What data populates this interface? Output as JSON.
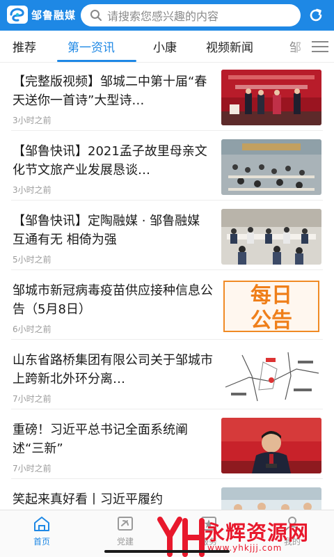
{
  "header": {
    "app_name": "邹鲁融媒",
    "search_placeholder": "请搜索您感兴趣的内容",
    "logo_icon": "app-logo-icon",
    "search_icon": "search-icon",
    "refresh_icon": "refresh-icon"
  },
  "tabs": [
    {
      "label": "推荐",
      "active": false
    },
    {
      "label": "第一资讯",
      "active": true
    },
    {
      "label": "小康",
      "active": false
    },
    {
      "label": "视频新闻",
      "active": false
    },
    {
      "label": "邹",
      "active": false
    }
  ],
  "feed": [
    {
      "title": "【完整版视频】邹城二中第十届“春天送你一首诗”大型诗…",
      "time": "3小时之前"
    },
    {
      "title": "【邹鲁快讯】2021孟子故里母亲文化节文旅产业发展恳谈…",
      "time": "3小时之前"
    },
    {
      "title": "【邹鲁快讯】定陶融媒 · 邹鲁融媒 互通有无 相倚为强",
      "time": "5小时之前"
    },
    {
      "title": "邹城市新冠病毒疫苗供应接种信息公告（5月8日）",
      "time": "6小时之前",
      "thumb_text": [
        "每日",
        "公告"
      ]
    },
    {
      "title": "山东省路桥集团有限公司关于邹城市上跨新北外环分离…",
      "time": "7小时之前"
    },
    {
      "title": "重磅！习近平总书记全面系统阐述“三新”",
      "time": "7小时之前"
    },
    {
      "title": "笑起来真好看丨习近平履约",
      "time": ""
    }
  ],
  "bottom_nav": [
    {
      "label": "首页",
      "icon": "home-icon",
      "active": true
    },
    {
      "label": "党建",
      "icon": "party-flag-icon",
      "active": false
    },
    {
      "label": "服务",
      "icon": "star-icon",
      "active": false
    },
    {
      "label": "我的",
      "icon": "user-icon",
      "active": false
    }
  ],
  "watermark": {
    "text": "永辉资源网",
    "url": "www.yhkjjj.com"
  },
  "colors": {
    "brand": "#1e88e5",
    "watermark": "#e8182c"
  }
}
